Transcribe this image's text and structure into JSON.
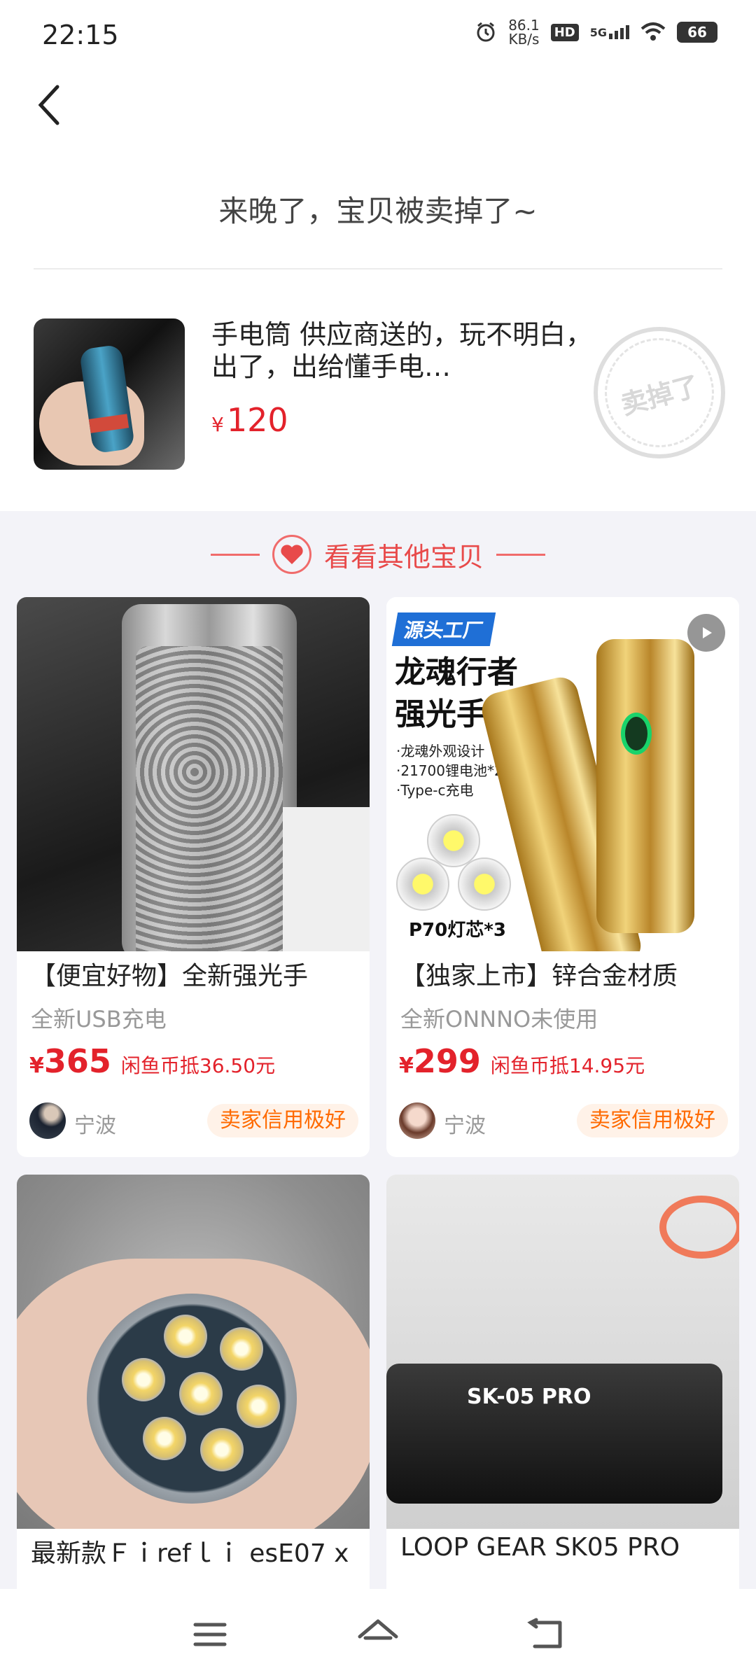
{
  "status_bar": {
    "time": "22:15",
    "net_speed_value": "86.1",
    "net_speed_unit": "KB/s",
    "hd_label": "HD",
    "network_label": "5G",
    "battery": "66"
  },
  "header": {
    "sold_message": "来晚了，宝贝被卖掉了~"
  },
  "sold_item": {
    "description": "手电筒 供应商送的，玩不明白，出了，出给懂手电…",
    "currency": "¥",
    "price": "120",
    "stamp_text": "卖掉了"
  },
  "recommend": {
    "title": "看看其他宝贝"
  },
  "cards": [
    {
      "title": "【便宜好物】全新强光手",
      "subtitle": "全新USB充电",
      "currency": "¥",
      "price": "365",
      "coin_text": "闲鱼币抵36.50元",
      "city": "宁波",
      "badge": "卖家信用极好"
    },
    {
      "title": "【独家上市】锌合金材质",
      "subtitle": "全新ONNNO未使用",
      "currency": "¥",
      "price": "299",
      "coin_text": "闲鱼币抵14.95元",
      "city": "宁波",
      "badge": "卖家信用极好",
      "image_text": {
        "tag": "源头工厂",
        "headline_1": "龙魂行者",
        "headline_2": "强光手电",
        "bullet_1": "·龙魂外观设计",
        "bullet_2": "·21700锂电池*2",
        "bullet_3": "·Type-c充电",
        "chip_label": "P70灯芯*3"
      }
    },
    {
      "title": "最新款Ｆｉrefｌｉ esE07 x"
    },
    {
      "title": "LOOP GEAR SK05 PRO",
      "image_text": {
        "model": "SK-05 PRO"
      }
    }
  ],
  "colors": {
    "price_red": "#e3222b",
    "accent_red": "#e84a4a",
    "credit_orange": "#ff6a00"
  }
}
